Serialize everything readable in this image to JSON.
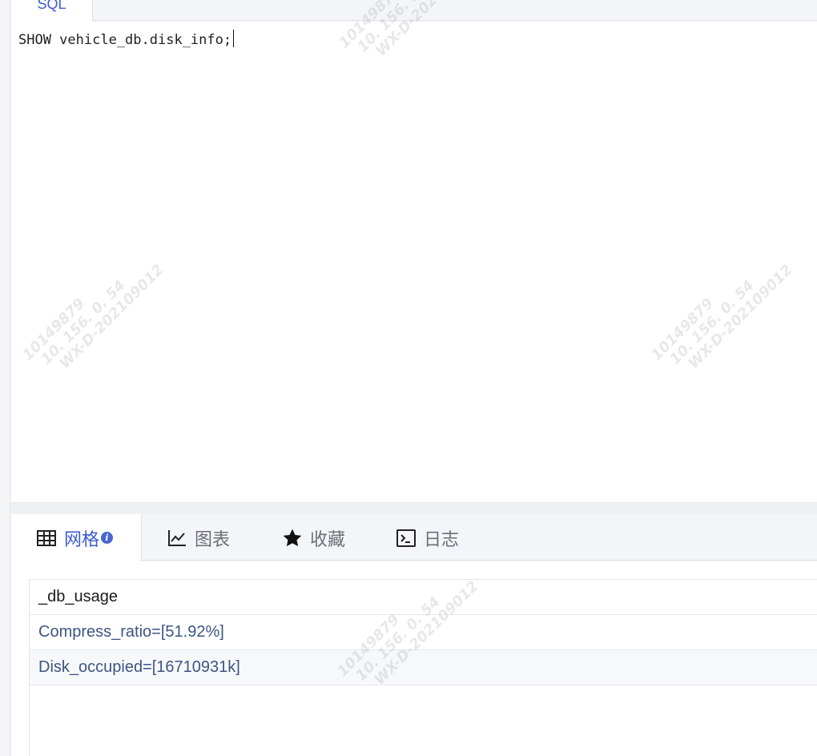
{
  "editor": {
    "tab_label": "SQL",
    "code": "SHOW vehicle_db.disk_info;"
  },
  "results": {
    "tabs": [
      {
        "label": "网格",
        "icon": "table-grid-icon",
        "active": true
      },
      {
        "label": "图表",
        "icon": "line-chart-icon",
        "active": false
      },
      {
        "label": "收藏",
        "icon": "star-icon",
        "active": false
      },
      {
        "label": "日志",
        "icon": "terminal-icon",
        "active": false
      }
    ],
    "info_badge": "i",
    "column_header": "_db_usage",
    "rows": [
      "Compress_ratio=[51.92%]",
      "Disk_occupied=[16710931k]"
    ]
  },
  "watermark": {
    "line1": "10149879",
    "line2": "10. 156. 0. 54",
    "line3": "WX-D-202109012"
  },
  "colors": {
    "accent": "#3c5bd0",
    "row_text": "#3d5585"
  }
}
